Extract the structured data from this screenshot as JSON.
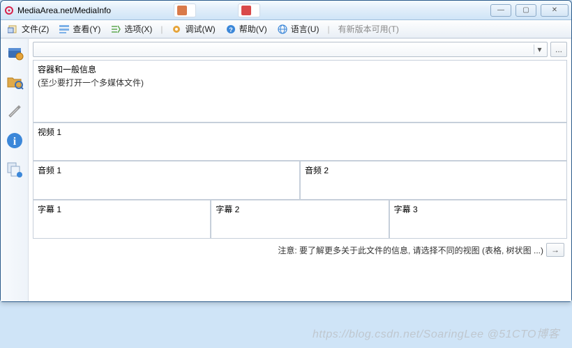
{
  "window": {
    "title": "MediaArea.net/MediaInfo",
    "tabs": [
      {
        "label": ""
      },
      {
        "label": ""
      }
    ],
    "controls": {
      "min": "—",
      "max": "▢",
      "close": "✕"
    }
  },
  "menu": {
    "file": {
      "label": "文件(Z)"
    },
    "view": {
      "label": "查看(Y)"
    },
    "options": {
      "label": "选项(X)"
    },
    "debug": {
      "label": "调试(W)"
    },
    "help": {
      "label": "帮助(V)"
    },
    "lang": {
      "label": "语言(U)"
    },
    "update": {
      "label": "有新版本可用(T)"
    }
  },
  "toolbar_icons": {
    "open_file": "open-file",
    "open_folder": "open-folder",
    "settings": "settings",
    "info": "info",
    "copy": "copy"
  },
  "combo": {
    "value": "",
    "browse_label": "..."
  },
  "panels": {
    "container": {
      "title": "容器和一般信息",
      "hint": "(至少要打开一个多媒体文件)"
    },
    "video1": {
      "title": "视频 1"
    },
    "audio1": {
      "title": "音频 1"
    },
    "audio2": {
      "title": "音频 2"
    },
    "sub1": {
      "title": "字幕 1"
    },
    "sub2": {
      "title": "字幕 2"
    },
    "sub3": {
      "title": "字幕 3"
    }
  },
  "note": {
    "text": "注意: 要了解更多关于此文件的信息, 请选择不同的视图 (表格, 树状图 ...)",
    "arrow": "→"
  },
  "watermark": "https://blog.csdn.net/SoaringLee  @51CTO博客"
}
